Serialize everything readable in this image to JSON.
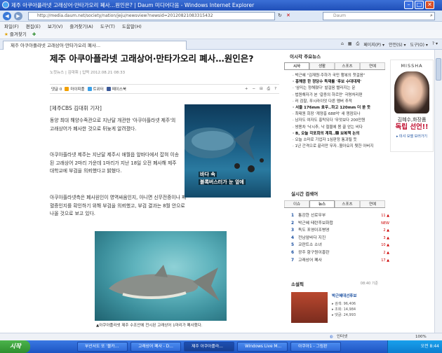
{
  "window": {
    "title": "제주 아쿠아플라넷 고래상어·만타가오리 폐사…원인은? | Daum 미디어다음 - Windows Internet Explorer"
  },
  "address": {
    "url": "http://media.daum.net/society/nation/jeju/newsview?newsid=20120821083315432",
    "search_placeholder": "Daum"
  },
  "menu": [
    "파일(F)",
    "편집(E)",
    "보기(V)",
    "즐겨찾기(A)",
    "도구(T)",
    "도움말(H)"
  ],
  "favorites": {
    "label": "즐겨찾기"
  },
  "tab": {
    "label": "제주 아쿠아플라넷 고래상어·만타가오리 폐사...",
    "tools": [
      "페이지(P) ▾",
      "안전(S) ▾",
      "도구(O) ▾",
      "? ▾"
    ]
  },
  "article": {
    "title": "제주 아쿠아플라넷 고래상어·만타가오리 폐사…원인은?",
    "byline": "노컷뉴스 | 김대휘 | 입력 2012.08.21 08:33",
    "share": {
      "comments": "댓글 0",
      "items": [
        "마이피플",
        "트위터",
        "페이스북"
      ],
      "tools": [
        "+",
        "−",
        "⊟",
        "⎙",
        "?"
      ]
    },
    "reporter": "[제주CBS 김대휘 기자]",
    "p1": "동양 최대 해양수족관으로 지난달 개관한 '아쿠아플라넷 제주'의 고래상어가 폐사한 것으로 뒤늦게 알려졌다.",
    "p2": "아쿠아플라넷 제주는 지난달 제주시 애월읍 앞바다에서 잡혀 이송된 고래상어 2마리 가운데 1마리가 지난 18일 오전 폐사해 제주대학교에 부검을 의뢰했다고 밝혔다.",
    "p3": "아쿠아플라넷측은 폐사원인이 영역싸움인지, 아니면 신무전증이나 패혈증인지를 확인하기 위해 부검을 의뢰했고, 부검 결과는 8월 안으로 나올 것으로 보고 있다.",
    "photo1_caption": [
      "바다 속",
      "블록버스터가 눈 앞에"
    ],
    "photo2_caption": "▲아쿠아플라넷 제주 수조안에 전시된 고래상어 1마리가 폐사했다."
  },
  "sidebar": {
    "head1": "이시각 주요뉴스",
    "tabs1": [
      "시사",
      "생활",
      "스포츠",
      "연예"
    ],
    "news": [
      {
        "t": "· 박근혜 \"김재원·주하가 국민 행복의 첫걸음\"",
        "b": false
      },
      {
        "t": "· 홍해종 한 정당수 독재를 '후보 수대대제'",
        "b": true
      },
      {
        "t": "· '삼미는 정해졌다' 발걸음 빨라지는 문",
        "b": false
      },
      {
        "t": "· 법원해자가 본 '갈증의 하르만' 극명처리편",
        "b": false
      },
      {
        "t": "· 러 검찰, 푸시라이엇 다른 멤버 추적",
        "b": false
      },
      {
        "t": "· 서울 176mm 호우..하고 120mm 더 쏟 듯",
        "b": true
      },
      {
        "t": "· 최태원 회장 '계양흥 688억' 새 쟁점되나",
        "b": false
      },
      {
        "t": "· 남자도 여자도 홍탁되다 '무엇보다 200만원",
        "b": false
      },
      {
        "t": "· 쌍용차 '낙시추, 낙 철물에 몸 끌 얻는 비다",
        "b": false
      },
      {
        "t": "· B, 오늘 각포회의 계획..韓 보복책 논의",
        "b": true
      },
      {
        "t": "· 오늘 소마로 기업자 1심판정 통과될 듯",
        "b": false
      },
      {
        "t": "· 1년 간격으로 끝리만 무자..뭘아요지 뭣한 아버지",
        "b": false
      }
    ],
    "head2": "실시간 검색어",
    "tabs2": [
      "이슈",
      "뉴스",
      "스포츠",
      "연예"
    ],
    "ranks": [
      {
        "n": "1",
        "t": "통강한 선로무부",
        "c": "11 ▲"
      },
      {
        "n": "2",
        "t": "박근혜 테란후보화합",
        "c": "NEW"
      },
      {
        "n": "3",
        "t": "독도 포영이조병영",
        "c": "2 ▲"
      },
      {
        "n": "4",
        "t": "전남앞바다 지진",
        "c": "3 ▲"
      },
      {
        "n": "5",
        "t": "코란트소 소녀",
        "c": "10 ▲"
      },
      {
        "n": "6",
        "t": "광주 항구원이흥란",
        "c": "2 ▲"
      },
      {
        "n": "7",
        "t": "고래상어 폐사",
        "c": "17 ▲"
      }
    ],
    "novel_head": "소설픽",
    "novel_time": "08:40 기준",
    "novel_title": "박근혜대선후보",
    "novel_stats": [
      "▸ 검색: 96,406",
      "▸ 조회: 14,984",
      "▸ 댓글: 24,993"
    ]
  },
  "ad": {
    "brand": "MISSHA",
    "name": "김혜수,화장품",
    "headline1": "독립 선언!!",
    "link": "▸ 미샤 모델 보러가기"
  },
  "status": {
    "left": "",
    "right": "인터넷",
    "zoom": "100%"
  },
  "taskbar": {
    "start": "시작",
    "tasks": [
      "부산서도 또 '몰카…",
      "고래상어 폐사 - D…",
      "제주 아쿠아플라…",
      "Windows Live M…",
      "아쿠아1 - 그림판"
    ],
    "clock": "오전 8:44"
  }
}
